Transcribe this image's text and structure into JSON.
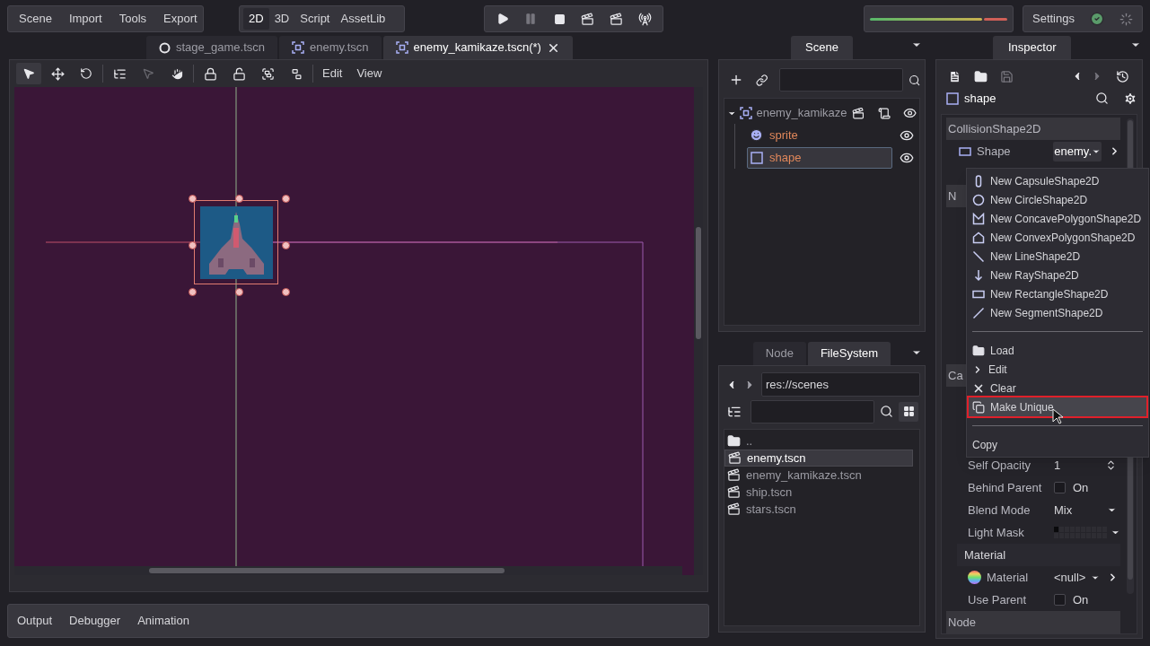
{
  "menu_bar": [
    "Scene",
    "Import",
    "Tools",
    "Export"
  ],
  "workspaces": [
    {
      "label": "2D",
      "selected": true
    },
    {
      "label": "3D",
      "selected": false
    },
    {
      "label": "Script",
      "selected": false
    },
    {
      "label": "AssetLib",
      "selected": false
    }
  ],
  "settings": {
    "label": "Settings"
  },
  "scene_tabs": [
    {
      "label": "stage_game.tscn",
      "kind": "circle",
      "selected": false
    },
    {
      "label": "enemy.tscn",
      "kind": "node2d",
      "selected": false
    },
    {
      "label": "enemy_kamikaze.tscn(*)",
      "kind": "node2d",
      "selected": true
    }
  ],
  "viewport_toolbar": {
    "menus": [
      "Edit",
      "View"
    ]
  },
  "bottom_tabs": [
    "Output",
    "Debugger",
    "Animation"
  ],
  "scene_dock": {
    "tab": "Scene",
    "tree": {
      "name": "enemy_kamikaze",
      "expanded": true,
      "children": [
        {
          "name": "sprite",
          "kind": "sprite",
          "selected": false
        },
        {
          "name": "shape",
          "kind": "shape",
          "selected": true
        }
      ]
    }
  },
  "filesystem_dock": {
    "tabs": [
      {
        "label": "Node",
        "selected": false
      },
      {
        "label": "FileSystem",
        "selected": true
      }
    ],
    "path": "res://scenes",
    "files": [
      {
        "name": "..",
        "kind": "folder",
        "selected": false
      },
      {
        "name": "enemy.tscn",
        "kind": "scene",
        "selected": true
      },
      {
        "name": "enemy_kamikaze.tscn",
        "kind": "scene",
        "selected": false
      },
      {
        "name": "ship.tscn",
        "kind": "scene",
        "selected": false
      },
      {
        "name": "stars.tscn",
        "kind": "scene",
        "selected": false
      }
    ]
  },
  "inspector": {
    "tab": "Inspector",
    "object": "shape",
    "rows": [
      {
        "kind": "category",
        "label": "CollisionShape2D"
      },
      {
        "kind": "resource",
        "label": "Shape",
        "value": "enemy."
      },
      {
        "kind": "category",
        "label": "N"
      },
      {
        "kind": "category",
        "label": "Ca"
      },
      {
        "kind": "number",
        "label": "Self Opacity",
        "value": "1"
      },
      {
        "kind": "check",
        "label": "Behind Parent",
        "value": "On",
        "checked": false
      },
      {
        "kind": "enum",
        "label": "Blend Mode",
        "value": "Mix"
      },
      {
        "kind": "layers",
        "label": "Light Mask"
      },
      {
        "kind": "group",
        "label": "Material"
      },
      {
        "kind": "material",
        "label": "Material",
        "value": "<null>"
      },
      {
        "kind": "check",
        "label": "Use Parent",
        "value": "On",
        "checked": false
      },
      {
        "kind": "category",
        "label": "Node"
      }
    ]
  },
  "context_menu": {
    "items": [
      {
        "kind": "capsule",
        "label": "New CapsuleShape2D",
        "selected": false
      },
      {
        "kind": "circle",
        "label": "New CircleShape2D",
        "selected": false
      },
      {
        "kind": "concave",
        "label": "New ConcavePolygonShape2D",
        "selected": false
      },
      {
        "kind": "convex",
        "label": "New ConvexPolygonShape2D",
        "selected": false
      },
      {
        "kind": "line",
        "label": "New LineShape2D",
        "selected": false
      },
      {
        "kind": "ray",
        "label": "New RayShape2D",
        "selected": false
      },
      {
        "kind": "rectangle",
        "label": "New RectangleShape2D",
        "selected": false
      },
      {
        "kind": "segment",
        "label": "New SegmentShape2D",
        "selected": false
      },
      {
        "kind": "separator"
      },
      {
        "kind": "load",
        "label": "Load",
        "selected": false
      },
      {
        "kind": "edit",
        "label": "Edit",
        "selected": false
      },
      {
        "kind": "clear",
        "label": "Clear",
        "selected": false
      },
      {
        "kind": "unique",
        "label": "Make Unique",
        "selected": true
      },
      {
        "kind": "separator"
      },
      {
        "kind": "plain",
        "label": "Copy",
        "selected": false
      }
    ]
  }
}
